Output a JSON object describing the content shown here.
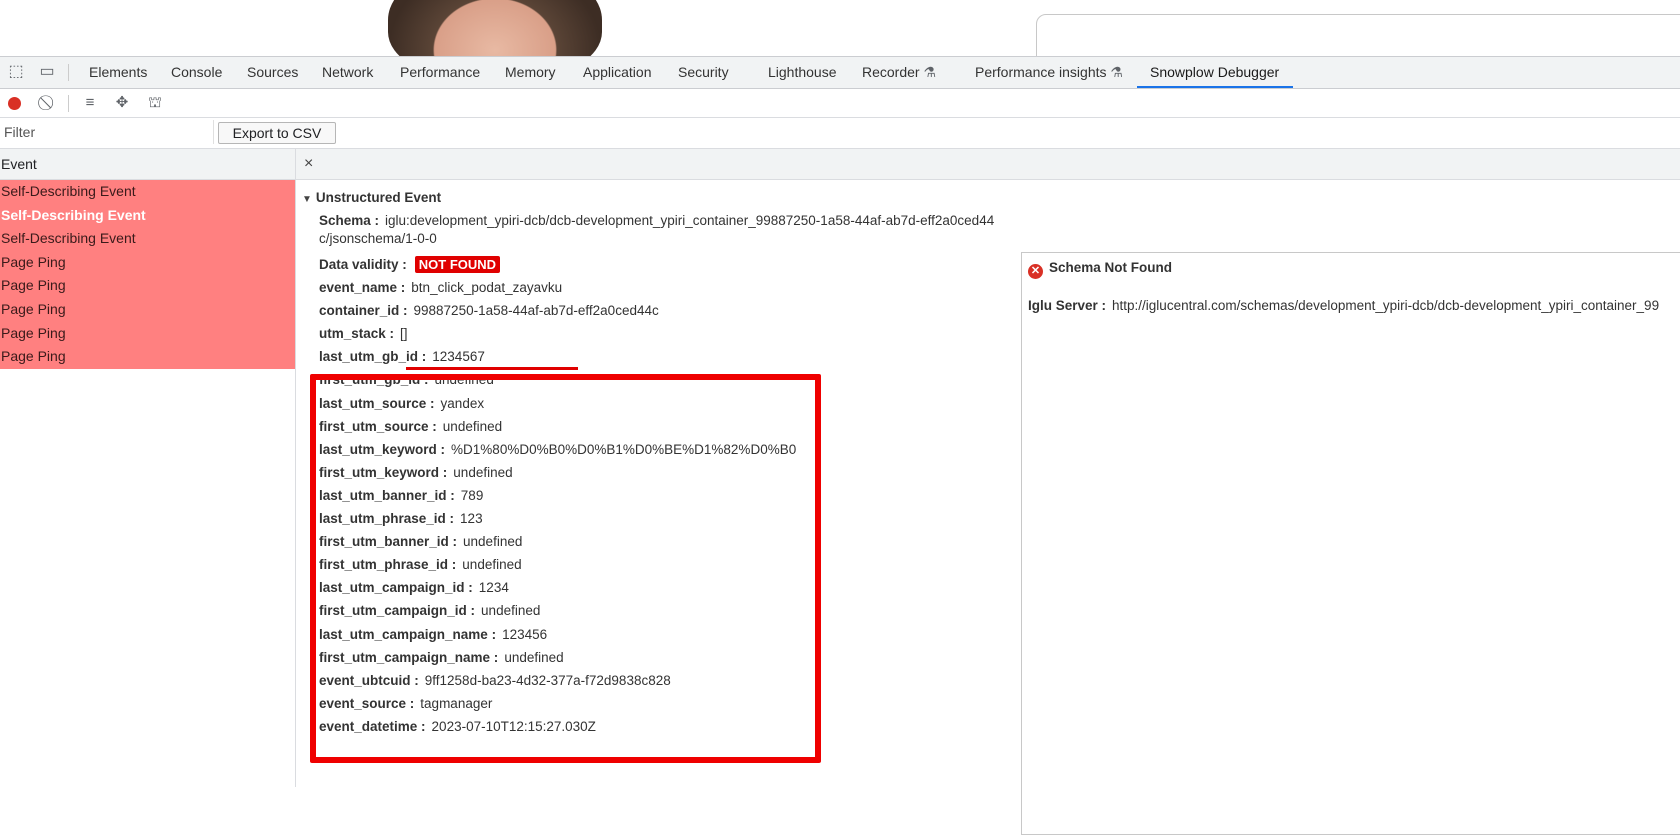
{
  "devtools": {
    "tabs": [
      "Elements",
      "Console",
      "Sources",
      "Network",
      "Performance",
      "Memory",
      "Application",
      "Security",
      "Lighthouse",
      "Recorder",
      "Performance insights",
      "Snowplow Debugger"
    ],
    "active_tab": "Snowplow Debugger"
  },
  "toolbar": {
    "filter_placeholder": "Filter",
    "export_label": "Export to CSV"
  },
  "events": {
    "header": "Event",
    "items": [
      {
        "label": "Self-Describing Event",
        "selected": false
      },
      {
        "label": "Self-Describing Event",
        "selected": true
      },
      {
        "label": "Self-Describing Event",
        "selected": false
      },
      {
        "label": "Page Ping",
        "selected": false
      },
      {
        "label": "Page Ping",
        "selected": false
      },
      {
        "label": "Page Ping",
        "selected": false
      },
      {
        "label": "Page Ping",
        "selected": false
      },
      {
        "label": "Page Ping",
        "selected": false
      }
    ],
    "row_color": "#ff8080"
  },
  "detail": {
    "close": "×",
    "section_title": "Unstructured Event",
    "schema_label": "Schema :",
    "schema_value_line1": "iglu:development_ypiri-dcb/dcb-development_ypiri_container_99887250-1a58-44af-ab7d-eff2a0ced44",
    "schema_value_line2": "c/jsonschema/1-0-0",
    "validity_label": "Data validity :",
    "validity_value": "NOT FOUND",
    "fields": [
      {
        "key": "event_name :",
        "value": "btn_click_podat_zayavku"
      },
      {
        "key": "container_id :",
        "value": "99887250-1a58-44af-ab7d-eff2a0ced44c"
      },
      {
        "key": "utm_stack :",
        "value": "[]"
      },
      {
        "key": "last_utm_gb_id :",
        "value": "1234567"
      },
      {
        "key": "first_utm_gb_id :",
        "value": "undefined"
      },
      {
        "key": "last_utm_source :",
        "value": "yandex"
      },
      {
        "key": "first_utm_source :",
        "value": "undefined"
      },
      {
        "key": "last_utm_keyword :",
        "value": "%D1%80%D0%B0%D0%B1%D0%BE%D1%82%D0%B0"
      },
      {
        "key": "first_utm_keyword :",
        "value": "undefined"
      },
      {
        "key": "last_utm_banner_id :",
        "value": "789"
      },
      {
        "key": "last_utm_phrase_id :",
        "value": "123"
      },
      {
        "key": "first_utm_banner_id :",
        "value": "undefined"
      },
      {
        "key": "first_utm_phrase_id :",
        "value": "undefined"
      },
      {
        "key": "last_utm_campaign_id :",
        "value": "1234"
      },
      {
        "key": "first_utm_campaign_id :",
        "value": "undefined"
      },
      {
        "key": "last_utm_campaign_name :",
        "value": "123456"
      },
      {
        "key": "first_utm_campaign_name :",
        "value": "undefined"
      },
      {
        "key": "event_ubtcuid :",
        "value": "9ff1258d-ba23-4d32-377a-f72d9838c828"
      },
      {
        "key": "event_source :",
        "value": "tagmanager"
      },
      {
        "key": "event_datetime :",
        "value": "2023-07-10T12:15:27.030Z"
      }
    ],
    "highlight_color": "#ef0000"
  },
  "schema_panel": {
    "title": "Schema Not Found",
    "iglu_label": "Iglu Server :",
    "iglu_value": "http://iglucentral.com/schemas/development_ypiri-dcb/dcb-development_ypiri_container_99"
  }
}
